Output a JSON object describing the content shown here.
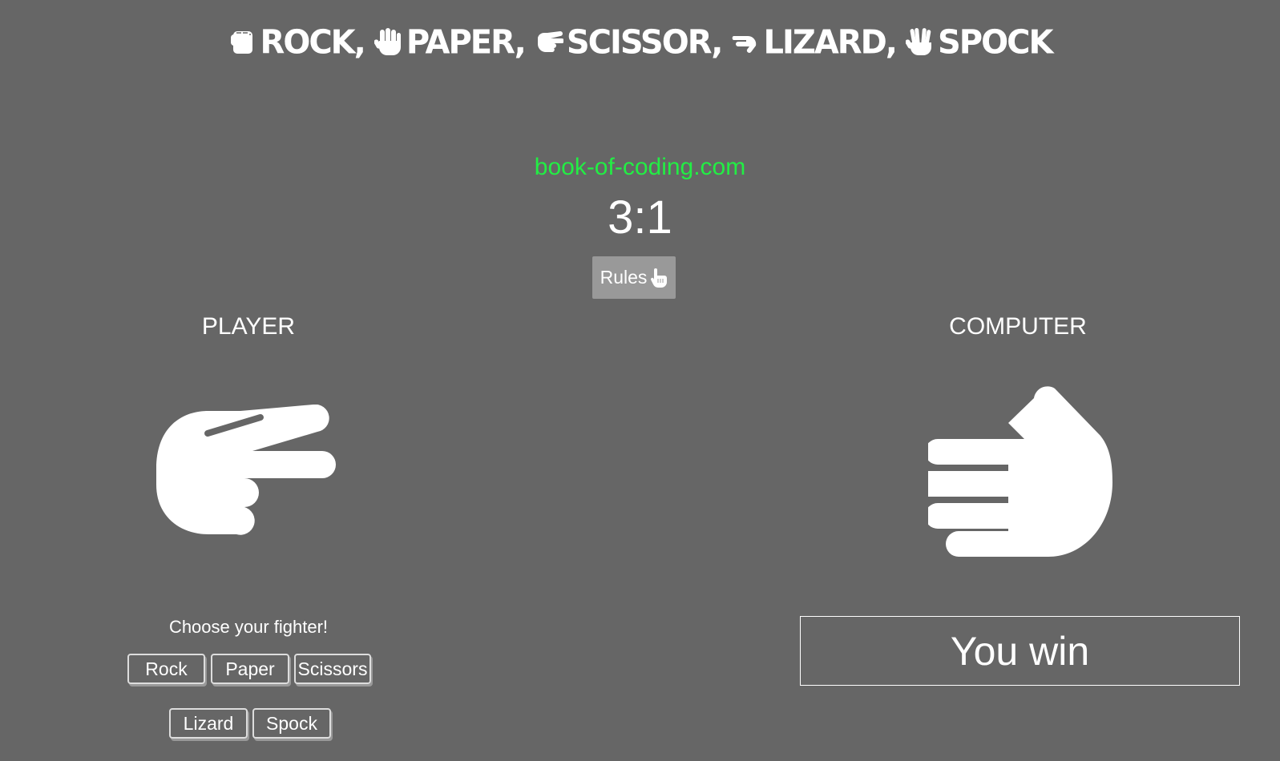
{
  "title": {
    "items": [
      {
        "icon": "rock-hand-icon",
        "label": "ROCK,"
      },
      {
        "icon": "paper-hand-icon",
        "label": "PAPER,"
      },
      {
        "icon": "scissors-hand-icon",
        "label": "SCISSOR,"
      },
      {
        "icon": "lizard-hand-icon",
        "label": "LIZARD,"
      },
      {
        "icon": "spock-hand-icon",
        "label": "SPOCK"
      }
    ]
  },
  "site": "book-of-coding.com",
  "score": "3:1",
  "rules_label": "Rules",
  "player": {
    "title": "PLAYER",
    "hand_icon": "scissors-hand-icon",
    "choose_label": "Choose your fighter!",
    "buttons": [
      "Rock",
      "Paper",
      "Scissors",
      "Lizard",
      "Spock"
    ]
  },
  "computer": {
    "title": "COMPUTER",
    "hand_icon": "lizard-hand-icon"
  },
  "result": "You win",
  "colors": {
    "background": "#666666",
    "site_link": "#22ee44",
    "rules_button": "#999999",
    "text": "#ffffff"
  }
}
